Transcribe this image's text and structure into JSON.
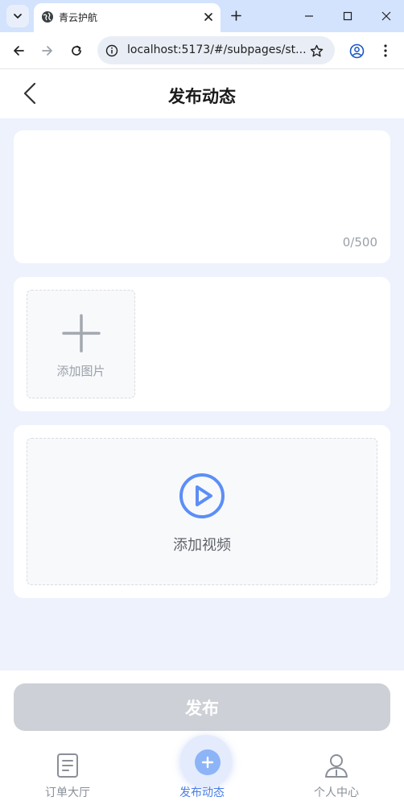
{
  "browser": {
    "tab_title": "青云护航",
    "url": "localhost:5173/#/subpages/st...",
    "accent": "#d3e3fd"
  },
  "header": {
    "title": "发布动态"
  },
  "text_card": {
    "char_count": "0/500"
  },
  "image_card": {
    "add_label": "添加图片"
  },
  "video_card": {
    "add_label": "添加视频",
    "icon_color": "#5b8ef7"
  },
  "publish": {
    "label": "发布",
    "color": "#cdd0d6"
  },
  "bottom_nav": {
    "items": [
      {
        "label": "订单大厅",
        "icon": "receipt-icon"
      },
      {
        "label": "发布动态",
        "icon": "plus-icon",
        "active": true
      },
      {
        "label": "个人中心",
        "icon": "user-icon"
      }
    ],
    "active_color": "#4a7fe8"
  }
}
